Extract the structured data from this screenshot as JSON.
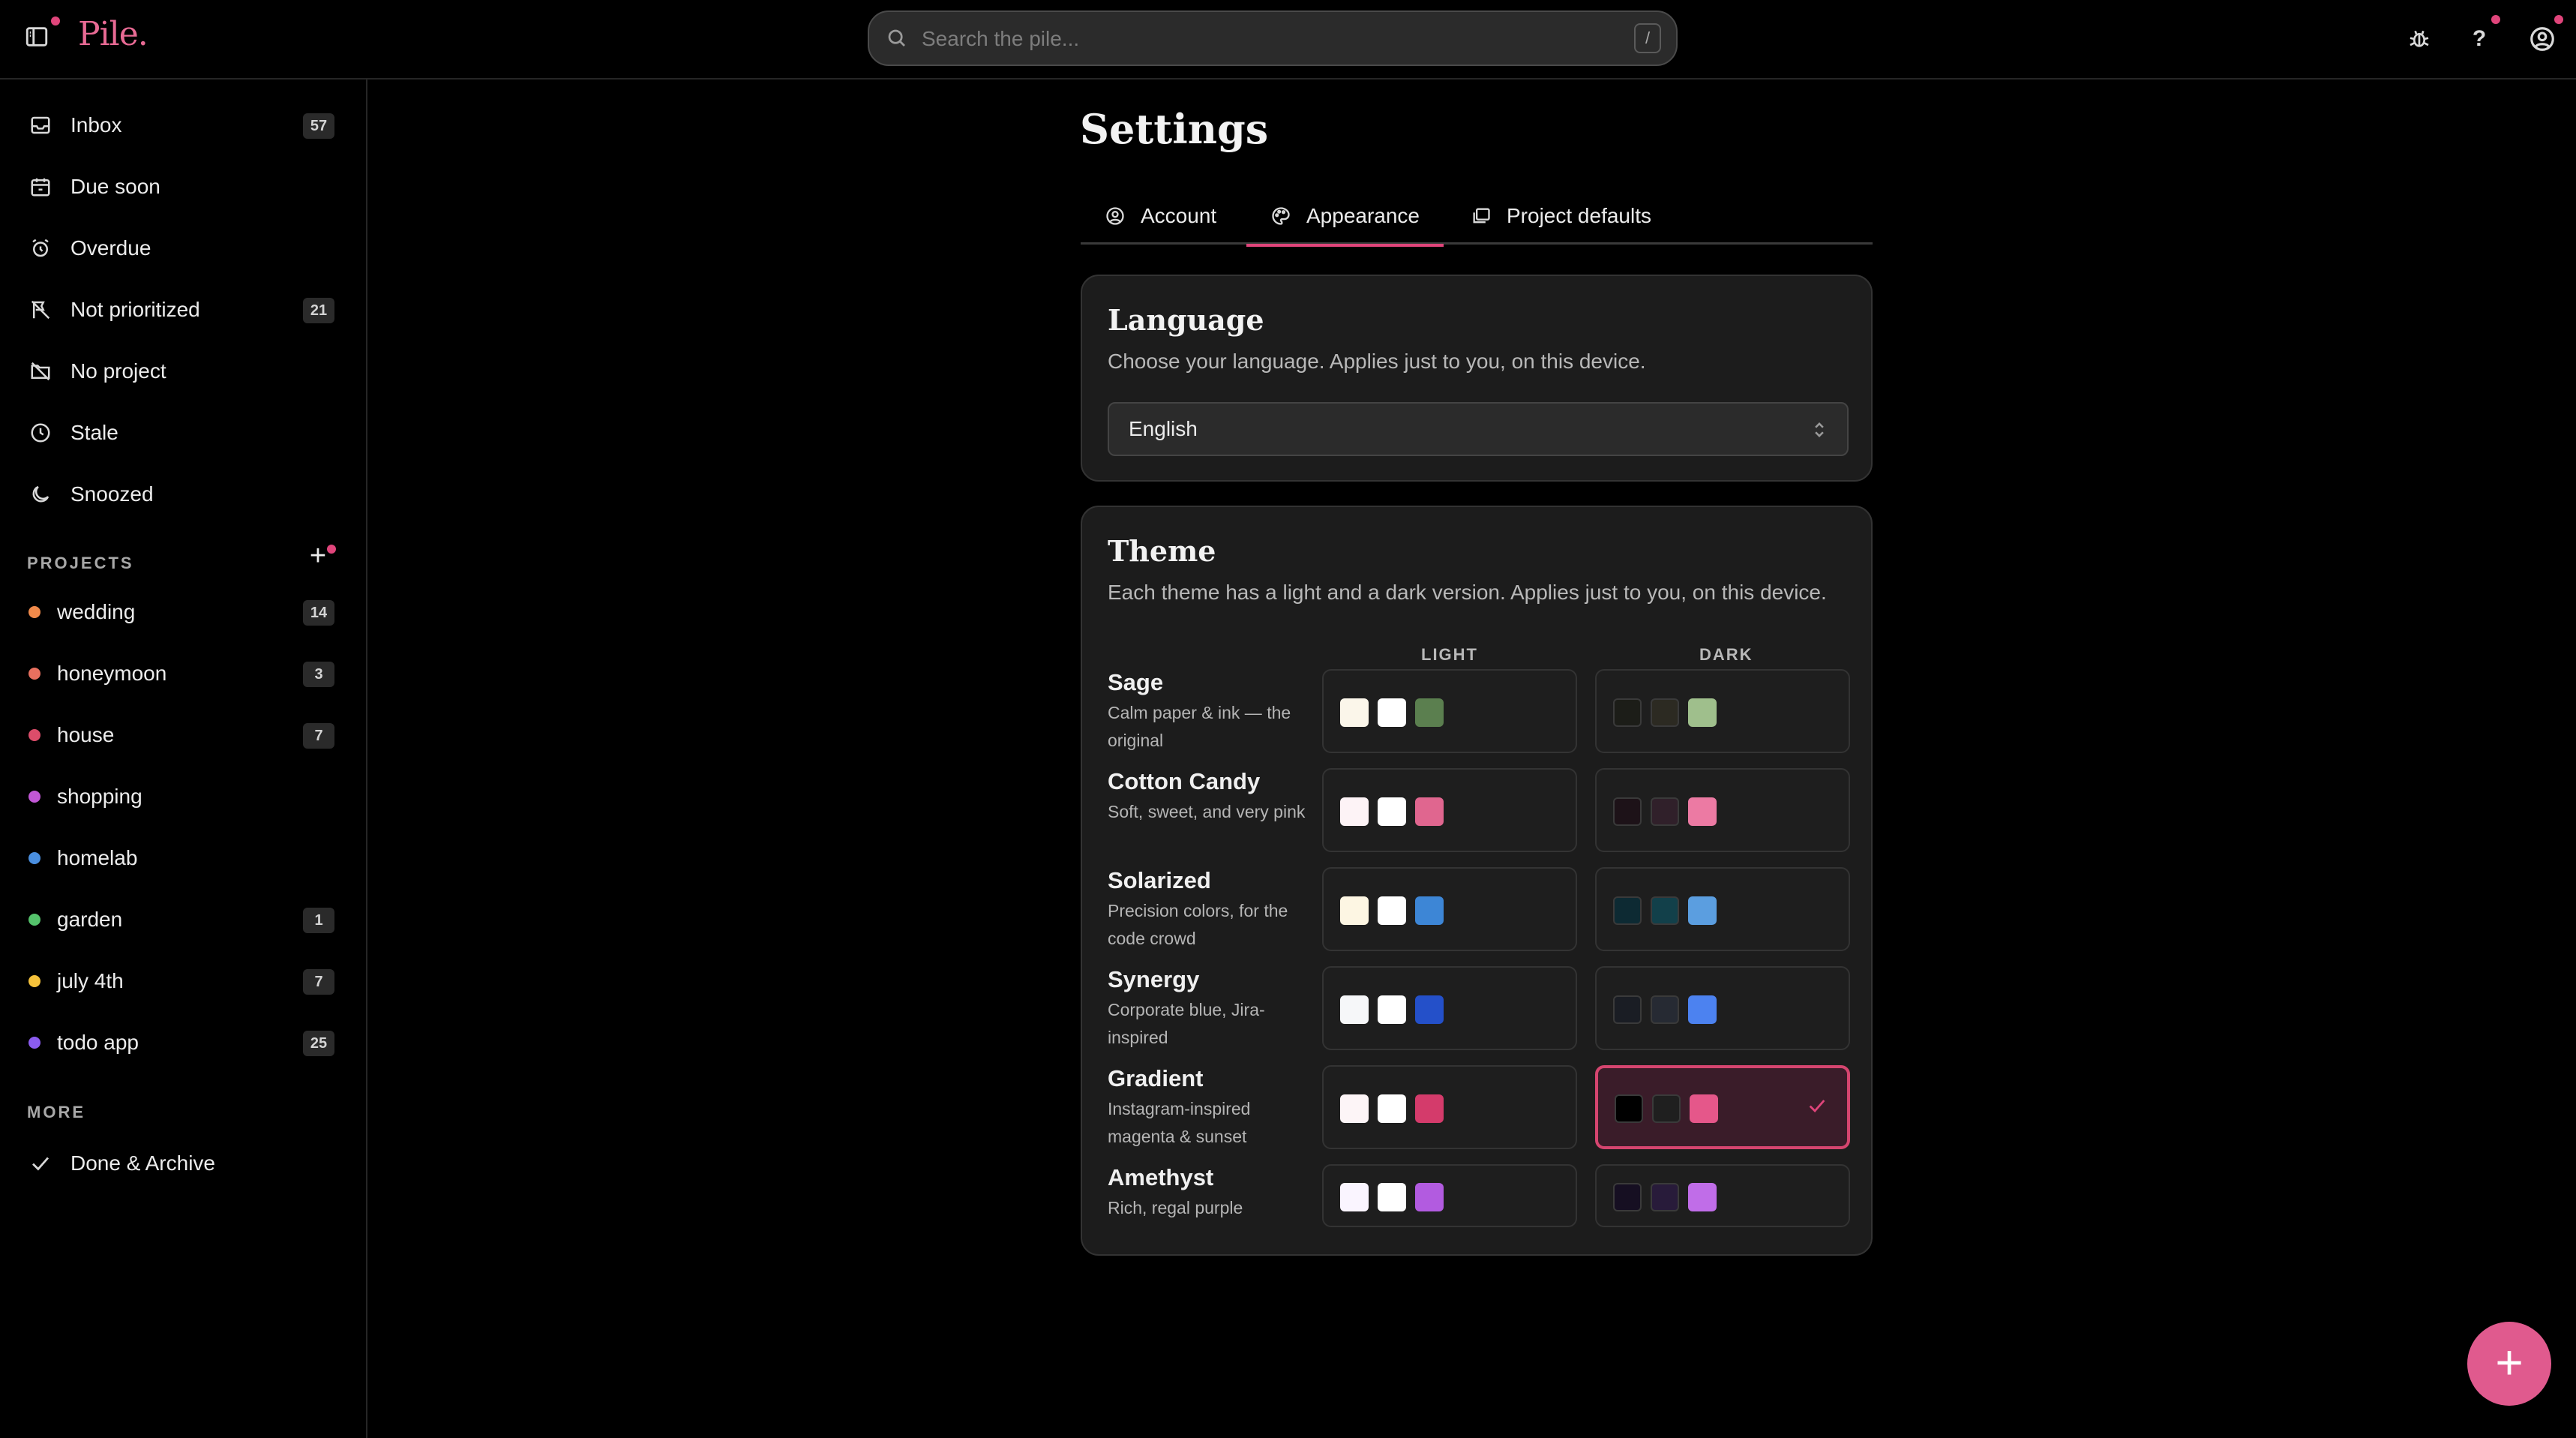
{
  "app": {
    "logo": "Pile."
  },
  "search": {
    "placeholder": "Search the pile...",
    "shortcut": "/"
  },
  "header": {
    "help_label": "?"
  },
  "sidebar": {
    "items": [
      {
        "label": "Inbox",
        "icon": "inbox-icon",
        "count": "57"
      },
      {
        "label": "Due soon",
        "icon": "calendar-icon",
        "count": ""
      },
      {
        "label": "Overdue",
        "icon": "alarm-icon",
        "count": ""
      },
      {
        "label": "Not prioritized",
        "icon": "flag-off-icon",
        "count": "21"
      },
      {
        "label": "No project",
        "icon": "folder-off-icon",
        "count": ""
      },
      {
        "label": "Stale",
        "icon": "clock-icon",
        "count": ""
      },
      {
        "label": "Snoozed",
        "icon": "moon-icon",
        "count": ""
      }
    ],
    "projects_title": "PROJECTS",
    "add_project": "+",
    "projects": [
      {
        "name": "wedding",
        "color": "#f08a4b",
        "count": "14"
      },
      {
        "name": "honeymoon",
        "color": "#e8705f",
        "count": "3"
      },
      {
        "name": "house",
        "color": "#dc4d6a",
        "count": "7"
      },
      {
        "name": "shopping",
        "color": "#c257d6",
        "count": ""
      },
      {
        "name": "homelab",
        "color": "#4a8fe0",
        "count": ""
      },
      {
        "name": "garden",
        "color": "#54c26b",
        "count": "1"
      },
      {
        "name": "july 4th",
        "color": "#f5c23b",
        "count": "7"
      },
      {
        "name": "todo app",
        "color": "#8b5cf0",
        "count": "25"
      }
    ],
    "more_title": "MORE",
    "more_items": [
      {
        "label": "Done & Archive",
        "icon": "check-icon"
      }
    ]
  },
  "settings": {
    "title": "Settings",
    "tabs": [
      {
        "label": "Account",
        "icon": "user-circle-icon",
        "active": false
      },
      {
        "label": "Appearance",
        "icon": "palette-icon",
        "active": true
      },
      {
        "label": "Project defaults",
        "icon": "folders-icon",
        "active": false
      }
    ],
    "language": {
      "title": "Language",
      "description": "Choose your language. Applies just to you, on this device.",
      "selected": "English"
    },
    "theme": {
      "title": "Theme",
      "description": "Each theme has a light and a dark version. Applies just to you, on this device.",
      "light_header": "LIGHT",
      "dark_header": "DARK",
      "themes": [
        {
          "name": "Sage",
          "description": "Calm paper & ink — the original",
          "light": [
            "#fbf6ea",
            "#ffffff",
            "#5b7f4f"
          ],
          "dark": [
            "#1c1d18",
            "#2c2a22",
            "#9fbf8c"
          ],
          "selected": ""
        },
        {
          "name": "Cotton Candy",
          "description": "Soft, sweet, and very pink",
          "light": [
            "#fdf3f6",
            "#ffffff",
            "#e0668f"
          ],
          "dark": [
            "#1d1218",
            "#30202a",
            "#ec7aa3"
          ],
          "selected": ""
        },
        {
          "name": "Solarized",
          "description": "Precision colors, for the code crowd",
          "light": [
            "#fdf6e3",
            "#ffffff",
            "#3d86d6"
          ],
          "dark": [
            "#0d2a33",
            "#12404a",
            "#5b9ee0"
          ],
          "selected": ""
        },
        {
          "name": "Synergy",
          "description": "Corporate blue, Jira-inspired",
          "light": [
            "#f6f7f9",
            "#ffffff",
            "#2450c9"
          ],
          "dark": [
            "#1a1d24",
            "#262a33",
            "#4c82f0"
          ],
          "selected": ""
        },
        {
          "name": "Gradient",
          "description": "Instagram-inspired magenta & sunset",
          "light": [
            "#fdf5f7",
            "#ffffff",
            "#d43b6b"
          ],
          "dark": [
            "#000000",
            "#1f1f1f",
            "#e5578a"
          ],
          "selected": "dark"
        },
        {
          "name": "Amethyst",
          "description": "Rich, regal purple",
          "light": [
            "#faf5ff",
            "#ffffff",
            "#b25be0"
          ],
          "dark": [
            "#160f22",
            "#281b3a",
            "#c06de8"
          ],
          "selected": ""
        }
      ]
    }
  },
  "fab": {
    "label": "+"
  },
  "colors": {
    "accent": "#e0457b",
    "background": "#000000",
    "card": "#1c1c1c"
  }
}
